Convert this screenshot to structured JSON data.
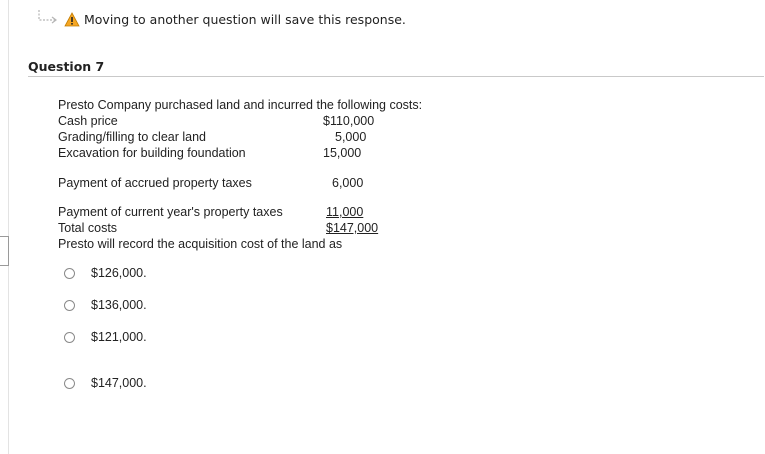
{
  "warning": {
    "text": "Moving to another question will save this response.",
    "icon": "warning-icon"
  },
  "question": {
    "title": "Question 7",
    "intro": "Presto Company purchased land and incurred the following costs:",
    "cost_lines": [
      {
        "label": "Cash price",
        "amount": "$110,000"
      },
      {
        "label": "Grading/filling to clear land",
        "amount": "5,000"
      },
      {
        "label": "Excavation for building foundation",
        "amount": "15,000"
      },
      {
        "label": "Payment of accrued property taxes",
        "amount": "6,000"
      },
      {
        "label": "Payment of current year's property taxes",
        "amount": "11,000"
      },
      {
        "label": "Total costs",
        "amount": "$147,000"
      }
    ],
    "prompt": "Presto will record the acquisition cost of the land as",
    "options": [
      "$126,000.",
      "$136,000.",
      "$121,000.",
      "$147,000."
    ]
  }
}
